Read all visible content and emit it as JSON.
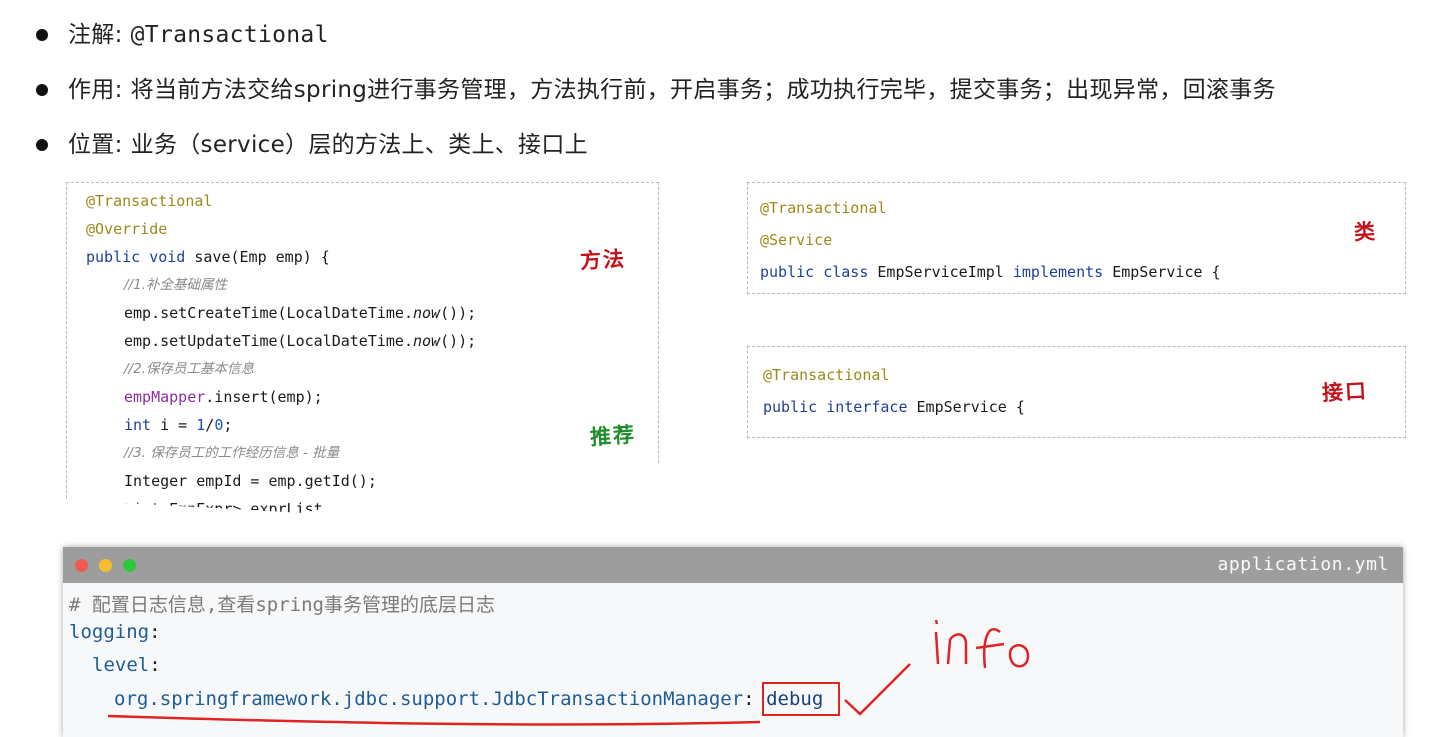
{
  "bullets": [
    {
      "label": "注解:",
      "value": "@Transactional"
    },
    {
      "label": "作用:",
      "value": "将当前方法交给spring进行事务管理，方法执行前，开启事务；成功执行完毕，提交事务；出现异常，回滚事务"
    },
    {
      "label": "位置:",
      "value": "业务（service）层的方法上、类上、接口上"
    }
  ],
  "method_box": {
    "handwriting_method": "方法",
    "handwriting_recommend": "推荐",
    "lines": {
      "ann_transactional": "@Transactional",
      "ann_override": "@Override",
      "public": "public",
      "void": "void",
      "save_sig": " save(Emp emp) {",
      "comment1": "//1.补全基础属性",
      "l_create_a": "emp.setCreateTime(LocalDateTime.",
      "l_now": "now",
      "l_create_b": "());",
      "l_update_a": "emp.setUpdateTime(LocalDateTime.",
      "comment2": "//2.保存员工基本信息",
      "mapper": "empMapper",
      "insert": ".insert(emp);",
      "int": "int",
      "i_eq": " i = ",
      "one": "1",
      "slash": "/",
      "zero": "0",
      "semi": ";",
      "comment3": "//3. 保存员工的工作经历信息 - 批量",
      "empid": "Integer empId = emp.getId();",
      "exprlist": "List<EmpExpr> exprList = e"
    }
  },
  "class_box": {
    "handwriting": "类",
    "ann_transactional": "@Transactional",
    "ann_service": "@Service",
    "public": "public",
    "class": "class",
    "impl_name": " EmpServiceImpl ",
    "implements": "implements",
    "iface": " EmpService {"
  },
  "interface_box": {
    "handwriting": "接口",
    "ann_transactional": "@Transactional",
    "public": "public",
    "interface": "interface",
    "iface": " EmpService {"
  },
  "editor": {
    "filename": "application.yml",
    "comment": "# 配置日志信息,查看spring事务管理的底层日志",
    "logging": "logging",
    "level": "level",
    "colon": ":",
    "manager_key": "org.springframework.jdbc.support.JdbcTransactionManager",
    "value": "debug",
    "handwritten_note": "info"
  },
  "colors": {
    "annotation": "#9b8a1b",
    "keyword": "#1f3f9f",
    "pen_red": "#e02424",
    "pen_green": "#1e8d2b"
  }
}
